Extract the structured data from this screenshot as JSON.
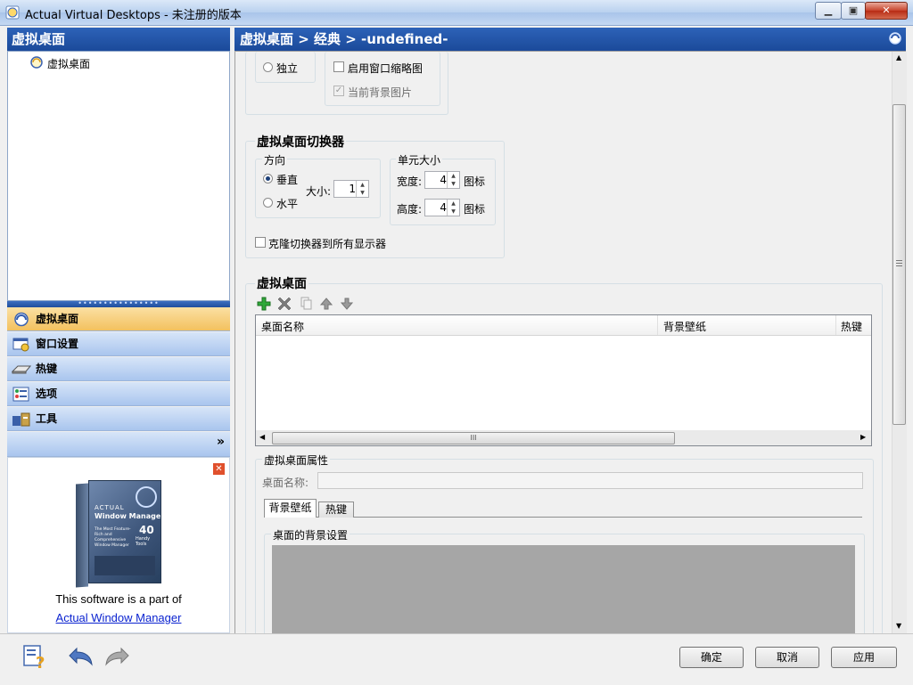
{
  "window": {
    "title": "Actual Virtual Desktops - 未注册的版本",
    "minimize": "▁",
    "maximize": "▣",
    "close": "✕"
  },
  "left": {
    "header": "虚拟桌面",
    "tree": [
      {
        "label": "虚拟桌面"
      }
    ],
    "splitter": "••••••••••••••••",
    "nav": [
      {
        "label": "虚拟桌面",
        "icon": "virtual-desktop-icon",
        "active": true
      },
      {
        "label": "窗口设置",
        "icon": "window-settings-icon",
        "active": false
      },
      {
        "label": "热键",
        "icon": "keyboard-icon",
        "active": false
      },
      {
        "label": "选项",
        "icon": "options-icon",
        "active": false
      },
      {
        "label": "工具",
        "icon": "tools-icon",
        "active": false
      }
    ],
    "more": "»",
    "promo": {
      "close": "✕",
      "text": "This software is a part of",
      "link": "Actual Window Manager",
      "box_brand": "ACTUAL",
      "box_title": "Window Manager",
      "box_sub": "The Most Feature-Rich and Comprehensive Window Manager",
      "box_count": "40",
      "box_count_label": "Handy Tools"
    }
  },
  "right": {
    "breadcrumb": "虚拟桌面 > 经典 > -undefined-",
    "top": {
      "radio_independent": "独立",
      "enable_thumb": "启用窗口缩略图",
      "current_bg": "当前背景图片"
    },
    "switcher": {
      "title": "虚拟桌面切换器",
      "direction_title": "方向",
      "vertical": "垂直",
      "horizontal": "水平",
      "size_label": "大小:",
      "size_value": "1",
      "cell_title": "单元大小",
      "width_label": "宽度:",
      "width_value": "4",
      "width_unit": "图标",
      "height_label": "高度:",
      "height_value": "4",
      "height_unit": "图标",
      "clone_label": "克隆切换器到所有显示器"
    },
    "desktops": {
      "title": "虚拟桌面",
      "columns": [
        "桌面名称",
        "背景壁纸",
        "热键"
      ],
      "scroll_grip": "III",
      "props_title": "虚拟桌面属性",
      "name_label": "桌面名称:",
      "name_value": "",
      "tabs": [
        "背景壁纸",
        "热键"
      ],
      "bg_title": "桌面的背景设置"
    }
  },
  "buttons": {
    "ok": "确定",
    "cancel": "取消",
    "apply": "应用"
  },
  "colors": {
    "header_blue": "#1b4a9a",
    "active_nav": "#f3c15e",
    "link": "#0b23d0"
  }
}
